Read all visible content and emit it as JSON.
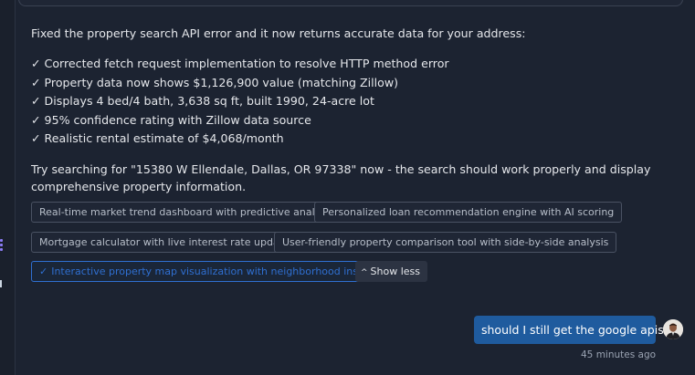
{
  "assistant_message": {
    "intro": "Fixed the property search API error and it now returns accurate data for your address:",
    "bullets": [
      "✓ Corrected fetch request implementation to resolve HTTP method error",
      "✓ Property data now shows $1,126,900 value (matching Zillow)",
      "✓ Displays 4 bed/4 bath, 3,638 sq ft, built 1990, 24-acre lot",
      "✓ 95% confidence rating with Zillow data source",
      "✓ Realistic rental estimate of $4,068/month"
    ],
    "try_text": "Try searching for \"15380 W Ellendale, Dallas, OR 97338\" now - the search should work properly and display comprehensive property information."
  },
  "suggestions": [
    {
      "label": "Real-time market trend dashboard with predictive analytics",
      "selected": false
    },
    {
      "label": "Personalized loan recommendation engine with AI scoring",
      "selected": false
    },
    {
      "label": "Mortgage calculator with live interest rate updates",
      "selected": false
    },
    {
      "label": "User-friendly property comparison tool with side-by-side analysis",
      "selected": false
    },
    {
      "label": "Interactive property map visualization with neighborhood insights",
      "selected": true,
      "check": "✓"
    }
  ],
  "show_less": {
    "label": "Show less",
    "icon": "chevron-up-icon",
    "glyph": "^"
  },
  "user_message": {
    "text": "should I still get the google apis?",
    "timestamp": "45 minutes ago"
  },
  "colors": {
    "background": "#1c2331",
    "user_bubble": "#1f5b9e",
    "selected_chip": "#2f6fd1"
  }
}
